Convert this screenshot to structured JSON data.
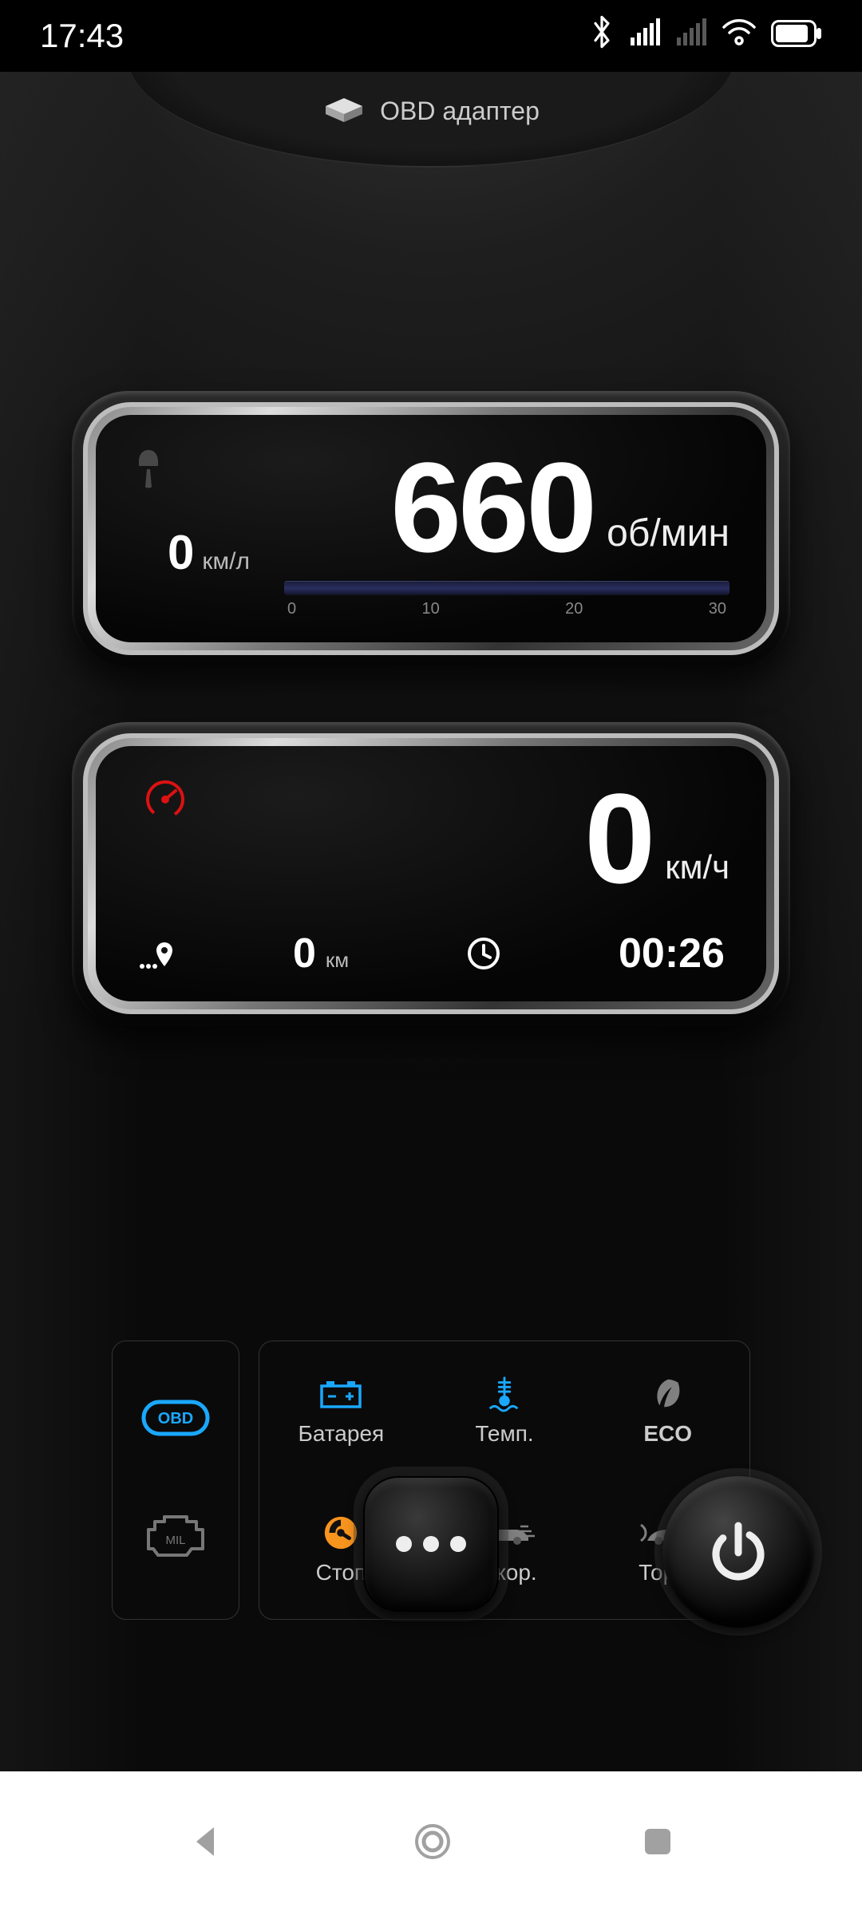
{
  "statusbar": {
    "time": "17:43"
  },
  "adapter": {
    "label": "OBD адаптер"
  },
  "rpm": {
    "value": "660",
    "unit": "об/мин",
    "fuel_value": "0",
    "fuel_unit": "км/л",
    "scale": {
      "t0": "0",
      "t1": "10",
      "t2": "20",
      "t3": "30"
    }
  },
  "speed": {
    "value": "0",
    "unit": "км/ч",
    "trip_value": "0",
    "trip_unit": "км",
    "time_value": "00:26"
  },
  "indicators": {
    "battery": "Батарея",
    "temp": "Темп.",
    "eco": "ECO",
    "stop": "Стоп",
    "accel": "Ускор.",
    "brake": "Торм."
  }
}
